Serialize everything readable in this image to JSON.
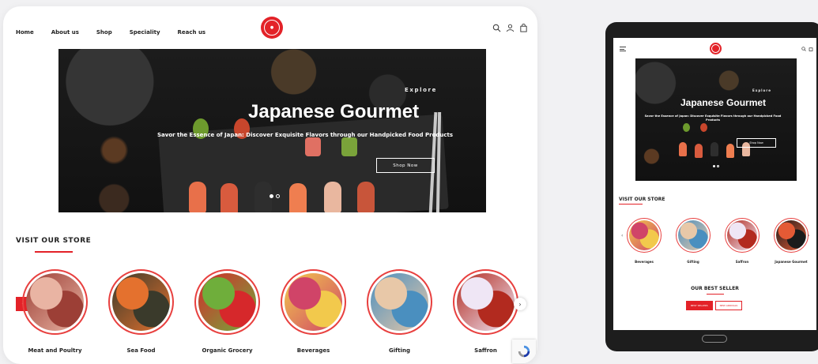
{
  "desktop": {
    "nav": [
      "Home",
      "About us",
      "Shop",
      "Speciality",
      "Reach us"
    ],
    "icons": [
      "search-icon",
      "user-icon",
      "bag-icon"
    ],
    "hero": {
      "eyebrow": "Explore",
      "title": "Japanese Gourmet",
      "subtitle": "Savor the Essence of Japan: Discover Exquisite Flavors through our Handpicked Food Products",
      "button": "Shop Now",
      "slides": 2,
      "active_slide": 1
    },
    "section_title": "VISIT OUR STORE",
    "categories": [
      {
        "label": "Meat and Poultry",
        "color_a": "#9c3f36",
        "color_b": "#e9b4a3"
      },
      {
        "label": "Sea Food",
        "color_a": "#3a3a2b",
        "color_b": "#e4712e"
      },
      {
        "label": "Organic Grocery",
        "color_a": "#d6282b",
        "color_b": "#6fae3b"
      },
      {
        "label": "Beverages",
        "color_a": "#f2c94c",
        "color_b": "#d04468"
      },
      {
        "label": "Gifting",
        "color_a": "#4a8fbf",
        "color_b": "#e8c8a8"
      },
      {
        "label": "Saffron",
        "color_a": "#b22a1f",
        "color_b": "#efe6f5"
      }
    ],
    "prev_arrow": "‹",
    "next_arrow": "›"
  },
  "tablet": {
    "hero": {
      "eyebrow": "Explore",
      "title": "Japanese Gourmet",
      "subtitle": "Savor the Essence of Japan: Discover Exquisite Flavors through our Handpicked Food Products",
      "button": "Shop Now"
    },
    "section_title": "VISIT OUR STORE",
    "categories": [
      {
        "label": "Beverages",
        "color_a": "#f2c94c",
        "color_b": "#d04468"
      },
      {
        "label": "Gifting",
        "color_a": "#4a8fbf",
        "color_b": "#e8c8a8"
      },
      {
        "label": "Saffron",
        "color_a": "#b22a1f",
        "color_b": "#efe6f5"
      },
      {
        "label": "Japanese Gourmet",
        "color_a": "#1b1b1b",
        "color_b": "#e45a35"
      }
    ],
    "best_seller_title": "OUR BEST SELLER",
    "tabs": [
      "BEST SELLERS",
      "NEW ARRIVALS"
    ],
    "prev_arrow": "‹",
    "next_arrow": "›"
  },
  "colors": {
    "accent": "#e32228",
    "page_bg": "#f1f1f3",
    "hero_bg": "#1a1a1a"
  }
}
